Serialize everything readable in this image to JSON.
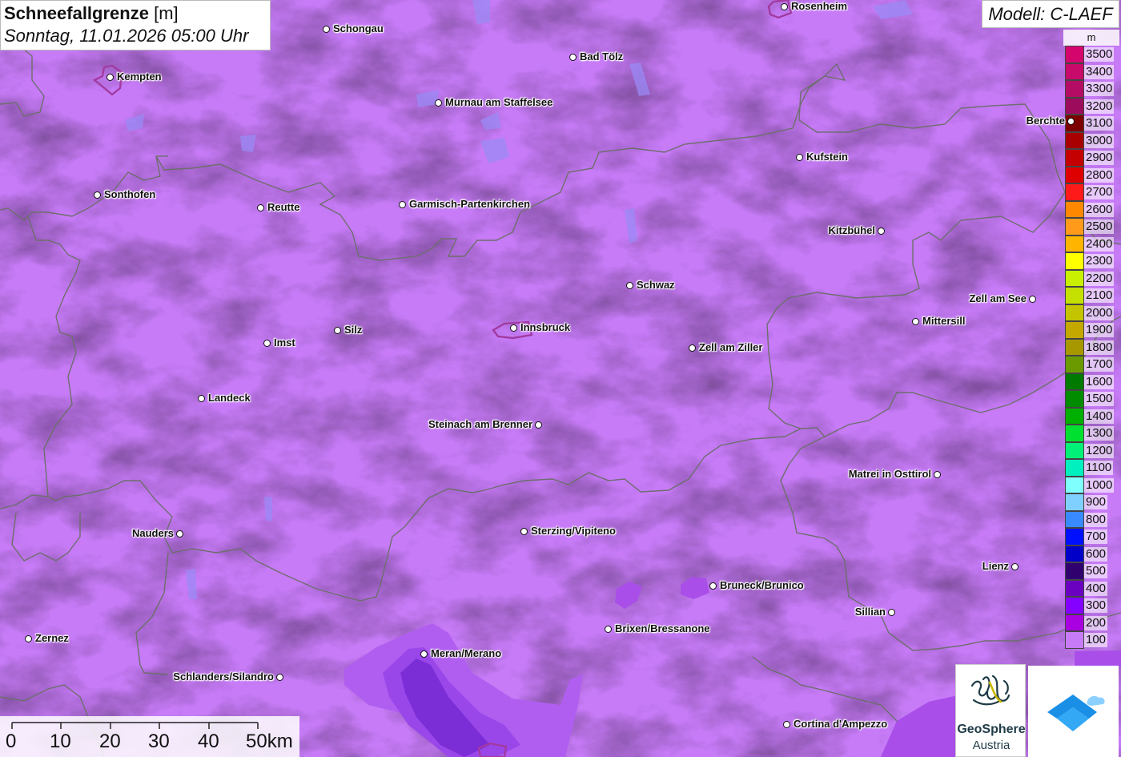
{
  "header": {
    "title": "Schneefallgrenze",
    "unit": "[m]",
    "datetime": "Sonntag, 11.01.2026 05:00 Uhr",
    "model": "Modell: C-LAEF"
  },
  "legend": {
    "unit": "m",
    "items": [
      {
        "value": "3500",
        "color": "#d4066e"
      },
      {
        "value": "3400",
        "color": "#c80a6a"
      },
      {
        "value": "3300",
        "color": "#b40c64"
      },
      {
        "value": "3200",
        "color": "#9c0b5c"
      },
      {
        "value": "3100",
        "color": "#7d0000"
      },
      {
        "value": "3000",
        "color": "#a80000"
      },
      {
        "value": "2900",
        "color": "#c40000"
      },
      {
        "value": "2800",
        "color": "#de0000"
      },
      {
        "value": "2700",
        "color": "#ff1a1a"
      },
      {
        "value": "2600",
        "color": "#ff8800"
      },
      {
        "value": "2500",
        "color": "#ff9a1a"
      },
      {
        "value": "2400",
        "color": "#ffb400"
      },
      {
        "value": "2300",
        "color": "#ffff00"
      },
      {
        "value": "2200",
        "color": "#c8f000"
      },
      {
        "value": "2100",
        "color": "#c4e000"
      },
      {
        "value": "2000",
        "color": "#c4c400"
      },
      {
        "value": "1900",
        "color": "#c4a800"
      },
      {
        "value": "1800",
        "color": "#a89800"
      },
      {
        "value": "1700",
        "color": "#6a9a00"
      },
      {
        "value": "1600",
        "color": "#007a00"
      },
      {
        "value": "1500",
        "color": "#008c00"
      },
      {
        "value": "1400",
        "color": "#00b000"
      },
      {
        "value": "1300",
        "color": "#00e030"
      },
      {
        "value": "1200",
        "color": "#00f078"
      },
      {
        "value": "1100",
        "color": "#00f0c0"
      },
      {
        "value": "1000",
        "color": "#80ffff"
      },
      {
        "value": "900",
        "color": "#80d0ff"
      },
      {
        "value": "800",
        "color": "#3a8aff"
      },
      {
        "value": "700",
        "color": "#0010ff"
      },
      {
        "value": "600",
        "color": "#0000c8"
      },
      {
        "value": "500",
        "color": "#30006e"
      },
      {
        "value": "400",
        "color": "#6a00c0"
      },
      {
        "value": "300",
        "color": "#8400ff"
      },
      {
        "value": "200",
        "color": "#a800e0"
      },
      {
        "value": "100",
        "color": "#c77bf7"
      }
    ]
  },
  "cities": [
    {
      "name": "Rosenheim"
    },
    {
      "name": "Schongau"
    },
    {
      "name": "Bad Tölz"
    },
    {
      "name": "Kempten"
    },
    {
      "name": "Murnau am Staffelsee"
    },
    {
      "name": "Berchte"
    },
    {
      "name": "Kufstein"
    },
    {
      "name": "Sonthofen"
    },
    {
      "name": "Reutte"
    },
    {
      "name": "Garmisch-Partenkirchen"
    },
    {
      "name": "Kitzbühel"
    },
    {
      "name": "Schwaz"
    },
    {
      "name": "Zell am See"
    },
    {
      "name": "Mittersill"
    },
    {
      "name": "Silz"
    },
    {
      "name": "Innsbruck"
    },
    {
      "name": "Imst"
    },
    {
      "name": "Zell am Ziller"
    },
    {
      "name": "Landeck"
    },
    {
      "name": "Steinach am Brenner"
    },
    {
      "name": "Matrei in Osttirol"
    },
    {
      "name": "Nauders"
    },
    {
      "name": "Sterzing/Vipiteno"
    },
    {
      "name": "Lienz"
    },
    {
      "name": "Bruneck/Brunico"
    },
    {
      "name": "Sillian"
    },
    {
      "name": "Brixen/Bressanone"
    },
    {
      "name": "Zernez"
    },
    {
      "name": "Meran/Merano"
    },
    {
      "name": "Schlanders/Silandro"
    },
    {
      "name": "Cortina d'Ampezzo"
    }
  ],
  "scale": {
    "labels": [
      "0",
      "10",
      "20",
      "30",
      "40",
      "50km"
    ]
  },
  "logos": {
    "geosphere_line1": "GeoSphere",
    "geosphere_line2": "Austria"
  }
}
